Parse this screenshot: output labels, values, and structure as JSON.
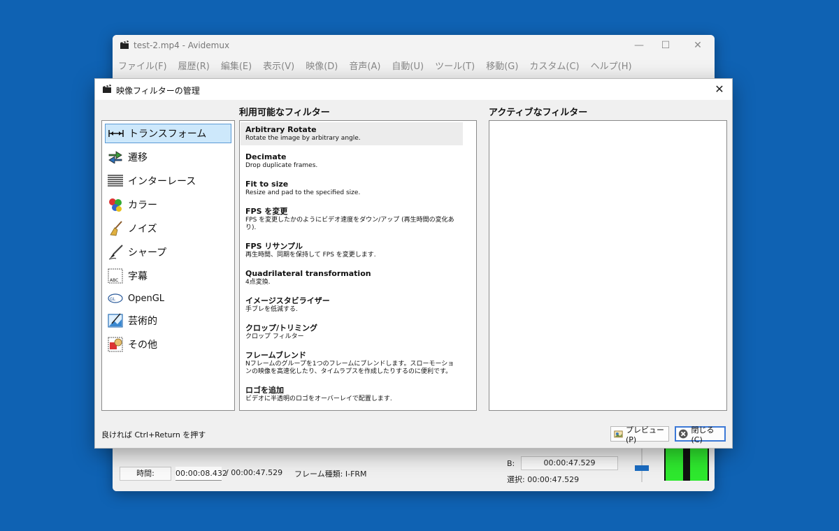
{
  "main_window": {
    "title": "test-2.mp4 - Avidemux",
    "controls": {
      "minimize": "—",
      "maximize": "☐",
      "close": "✕"
    },
    "menu": [
      "ファイル(F)",
      "履歴(R)",
      "編集(E)",
      "表示(V)",
      "映像(D)",
      "音声(A)",
      "自動(U)",
      "ツール(T)",
      "移動(G)",
      "カスタム(C)",
      "ヘルプ(H)"
    ],
    "time_label": "時間:",
    "time_current": "00:00:08.432",
    "time_total": "/ 00:00:47.529",
    "frame_type": "フレーム種類: I-FRM",
    "b_label": "B:",
    "b_value": "00:00:47.529",
    "selection": "選択: 00:00:47.529"
  },
  "dialog": {
    "title": "映像フィルターの管理",
    "close": "✕",
    "categories": [
      {
        "label": "トランスフォーム",
        "icon": "transform-icon",
        "selected": true
      },
      {
        "label": "遷移",
        "icon": "transition-icon"
      },
      {
        "label": "インターレース",
        "icon": "interlace-icon"
      },
      {
        "label": "カラー",
        "icon": "color-icon"
      },
      {
        "label": "ノイズ",
        "icon": "noise-broom-icon"
      },
      {
        "label": "シャープ",
        "icon": "sharp-brush-icon"
      },
      {
        "label": "字幕",
        "icon": "subtitle-icon"
      },
      {
        "label": "OpenGL",
        "icon": "opengl-icon"
      },
      {
        "label": "芸術的",
        "icon": "artistic-icon"
      },
      {
        "label": "その他",
        "icon": "misc-icon"
      }
    ],
    "available_header": "利用可能なフィルター",
    "active_header": "アクティブなフィルター",
    "filters": [
      {
        "name": "Arbitrary Rotate",
        "desc": "Rotate the image by arbitrary angle."
      },
      {
        "name": "Decimate",
        "desc": "Drop duplicate frames."
      },
      {
        "name": "Fit to size",
        "desc": "Resize and pad to the specified size."
      },
      {
        "name": "FPS を変更",
        "desc": "FPS を変更したかのようにビデオ速度をダウン/アップ (再生時間の変化あり)."
      },
      {
        "name": "FPS リサンプル",
        "desc": "再生時間、同期を保持して FPS を変更します."
      },
      {
        "name": "Quadrilateral transformation",
        "desc": "4点変換."
      },
      {
        "name": "イメージスタビライザー",
        "desc": "手ブレを低減する."
      },
      {
        "name": "クロップ/トリミング",
        "desc": "クロップ フィルター"
      },
      {
        "name": "フレームブレンド",
        "desc": "Nフレームのグループを1つのフレームにブレンドします。スローモーションの映像を高速化したり、タイムラプスを作成したりするのに便利です。"
      },
      {
        "name": "ロゴを追加",
        "desc": "ビデオに半透明のロゴをオーバーレイで配置します."
      }
    ],
    "hint": "良ければ Ctrl+Return を押す",
    "preview_button": "プレビュー(P)",
    "close_button": "閉じる(C)"
  },
  "colors": {
    "desktop": "#0f62b3",
    "selection": "#cde8fb",
    "accent": "#3b78d6",
    "meter": "#2ee82e"
  }
}
